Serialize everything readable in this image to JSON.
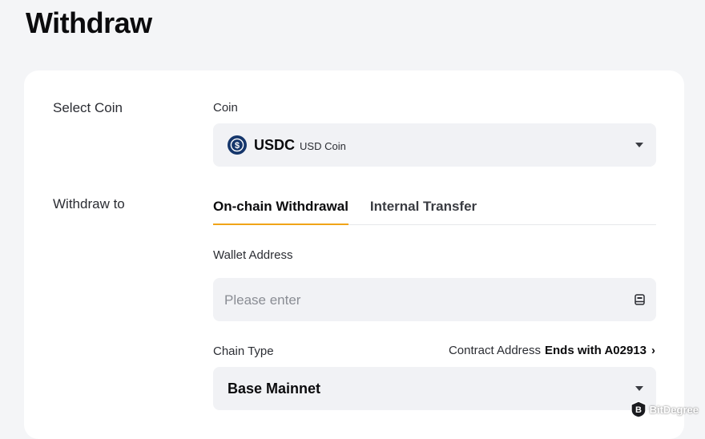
{
  "page": {
    "title": "Withdraw"
  },
  "select_coin": {
    "row_label": "Select Coin",
    "field_label": "Coin",
    "selected_symbol": "USDC",
    "selected_name": "USD Coin",
    "icon": "usdc-coin-icon"
  },
  "withdraw_to": {
    "row_label": "Withdraw to",
    "tabs": [
      {
        "label": "On-chain Withdrawal",
        "active": true
      },
      {
        "label": "Internal Transfer",
        "active": false
      }
    ]
  },
  "wallet_address": {
    "label": "Wallet Address",
    "value": "",
    "placeholder": "Please enter",
    "icon": "address-book-icon"
  },
  "chain_type": {
    "label": "Chain Type",
    "contract_prefix": "Contract Address",
    "contract_suffix": "Ends with A02913",
    "contract_chevron": "›",
    "selected": "Base Mainnet"
  },
  "watermark": {
    "text": "BitDegree"
  },
  "colors": {
    "accent": "#f0a418",
    "field_bg": "#f1f2f5",
    "page_bg": "#f4f5f7",
    "coin_icon": "#15366b"
  }
}
